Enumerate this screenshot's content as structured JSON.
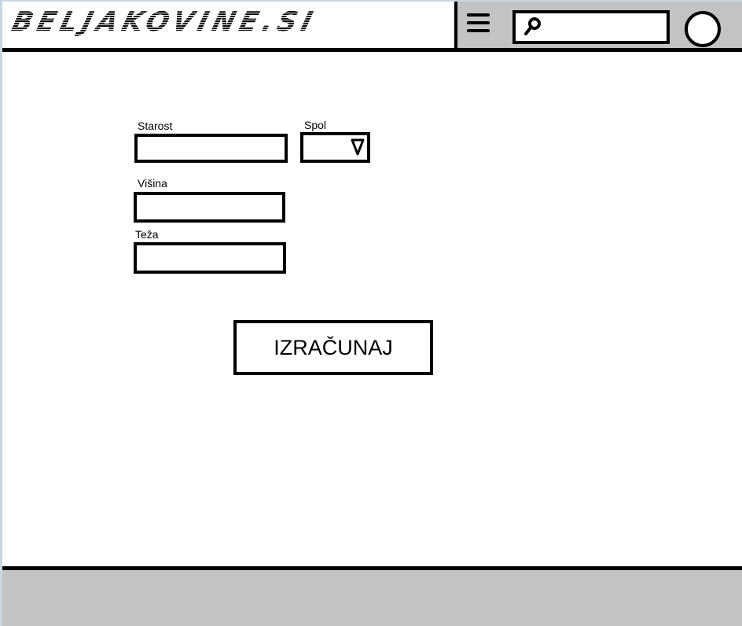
{
  "header": {
    "logo_text": "BELJAKOVINE.SI",
    "menu_icon": "hamburger-menu-icon",
    "search_icon": "search-magnifier-icon",
    "search_value": "",
    "avatar_icon": "user-avatar-circle"
  },
  "form": {
    "age_label": "Starost",
    "age_value": "",
    "gender_label": "Spol",
    "gender_value": "",
    "gender_arrow_icon": "dropdown-triangle-icon",
    "height_label": "Višina",
    "height_value": "",
    "weight_label": "Teža",
    "weight_value": "",
    "submit_label": "IZRAČUNAJ"
  },
  "colors": {
    "header_right_bg": "#c3c3c3",
    "footer_bg": "#c3c3c3",
    "border": "#000000",
    "background": "#ffffff"
  }
}
